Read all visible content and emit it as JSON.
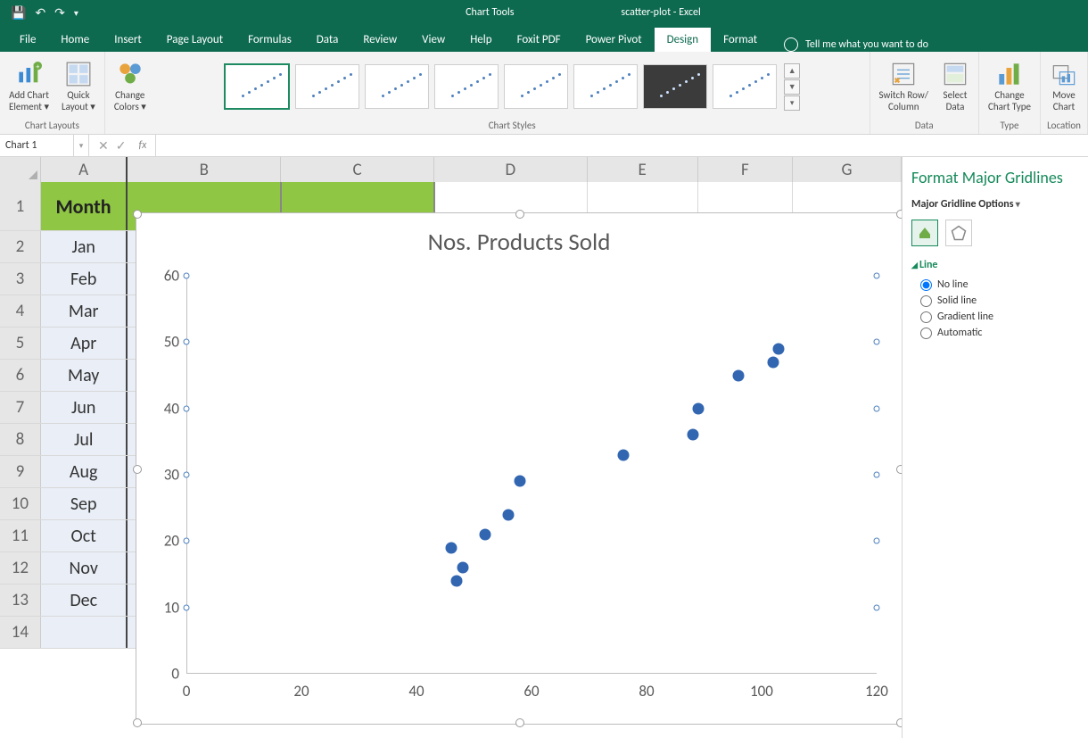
{
  "titlebar": {
    "chart_tools": "Chart Tools",
    "workbook_title": "scatter-plot - Excel"
  },
  "tabs": {
    "file": "File",
    "home": "Home",
    "insert": "Insert",
    "page_layout": "Page Layout",
    "formulas": "Formulas",
    "data": "Data",
    "review": "Review",
    "view": "View",
    "help": "Help",
    "foxit": "Foxit PDF",
    "power_pivot": "Power Pivot",
    "design": "Design",
    "format": "Format",
    "tellme": "Tell me what you want to do"
  },
  "ribbon": {
    "add_chart_element": "Add Chart\nElement ▾",
    "quick_layout": "Quick\nLayout ▾",
    "group_chart_layouts": "Chart Layouts",
    "change_colors": "Change\nColors ▾",
    "group_chart_styles": "Chart Styles",
    "switch_row_col": "Switch Row/\nColumn",
    "select_data": "Select\nData",
    "group_data": "Data",
    "change_chart_type": "Change\nChart Type",
    "group_type": "Type",
    "move_chart": "Move\nChart",
    "group_location": "Location"
  },
  "namebox": "Chart 1",
  "fx": "fx",
  "columns": [
    "A",
    "B",
    "C",
    "D",
    "E",
    "F",
    "G"
  ],
  "header_cell": "Month",
  "months": [
    "Jan",
    "Feb",
    "Mar",
    "Apr",
    "May",
    "Jun",
    "Jul",
    "Aug",
    "Sep",
    "Oct",
    "Nov",
    "Dec"
  ],
  "side_pane": {
    "title": "Format Major Gridlines",
    "subtitle": "Major Gridline Options",
    "section": "Line",
    "options": {
      "no_line": "No line",
      "solid_line": "Solid line",
      "gradient_line": "Gradient line",
      "automatic": "Automatic"
    },
    "selected": "no_line"
  },
  "chart_data": {
    "type": "scatter",
    "title": "Nos. Products Sold",
    "xlabel": "",
    "ylabel": "",
    "xlim": [
      0,
      120
    ],
    "ylim": [
      0,
      60
    ],
    "x_ticks": [
      0,
      20,
      40,
      60,
      80,
      100,
      120
    ],
    "y_ticks": [
      0,
      10,
      20,
      30,
      40,
      50,
      60
    ],
    "x": [
      46,
      47,
      48,
      52,
      56,
      58,
      76,
      88,
      89,
      96,
      102,
      103
    ],
    "y": [
      19,
      14,
      16,
      21,
      24,
      29,
      33,
      36,
      40,
      45,
      47,
      49
    ]
  }
}
